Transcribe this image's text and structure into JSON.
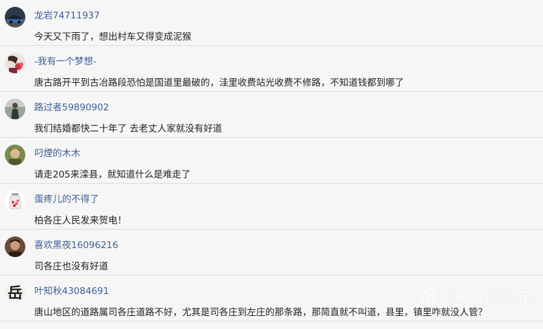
{
  "comments": [
    {
      "username": "龙岩74711937",
      "text": "今天又下雨了，想出村车又得变成泥猴",
      "avatar_icon": "car-avatar-icon"
    },
    {
      "username": "-我有一个梦想-",
      "text": "唐古路开平到古冶路段恐怕是国道里最破的，洼里收费站光收费不修路，不知道钱都到哪了",
      "avatar_icon": "flower-avatar-icon"
    },
    {
      "username": "路过者59890902",
      "text": "我们结婚都快二十年了 去老丈人家就没有好道",
      "avatar_icon": "person-standing-avatar-icon"
    },
    {
      "username": "叼煙的木木",
      "text": "请走205来滦县，就知道什么是难走了",
      "avatar_icon": "photo-avatar-icon"
    },
    {
      "username": "蛋疼儿的不得了",
      "text": "柏各庄人民发来贺电！",
      "avatar_icon": "jar-avatar-icon"
    },
    {
      "username": "喜欢黑夜16096216",
      "text": "司各庄也没有好道",
      "avatar_icon": "portrait-avatar-icon"
    },
    {
      "username": "叶知秋43084691",
      "text": "唐山地区的道路属司各庄道路不好，尤其是司各庄到左庄的那条路，那简直就不叫道，县里，镇里咋就没人管？",
      "avatar_icon": "calligraphy-yue-avatar-icon",
      "avatar_char": "岳"
    }
  ],
  "watermark": {
    "text": "唐山信息港"
  },
  "colors": {
    "username": "#3d5f95",
    "text": "#222222",
    "background": "#f6f6f6",
    "divider": "#dcdcdc"
  }
}
